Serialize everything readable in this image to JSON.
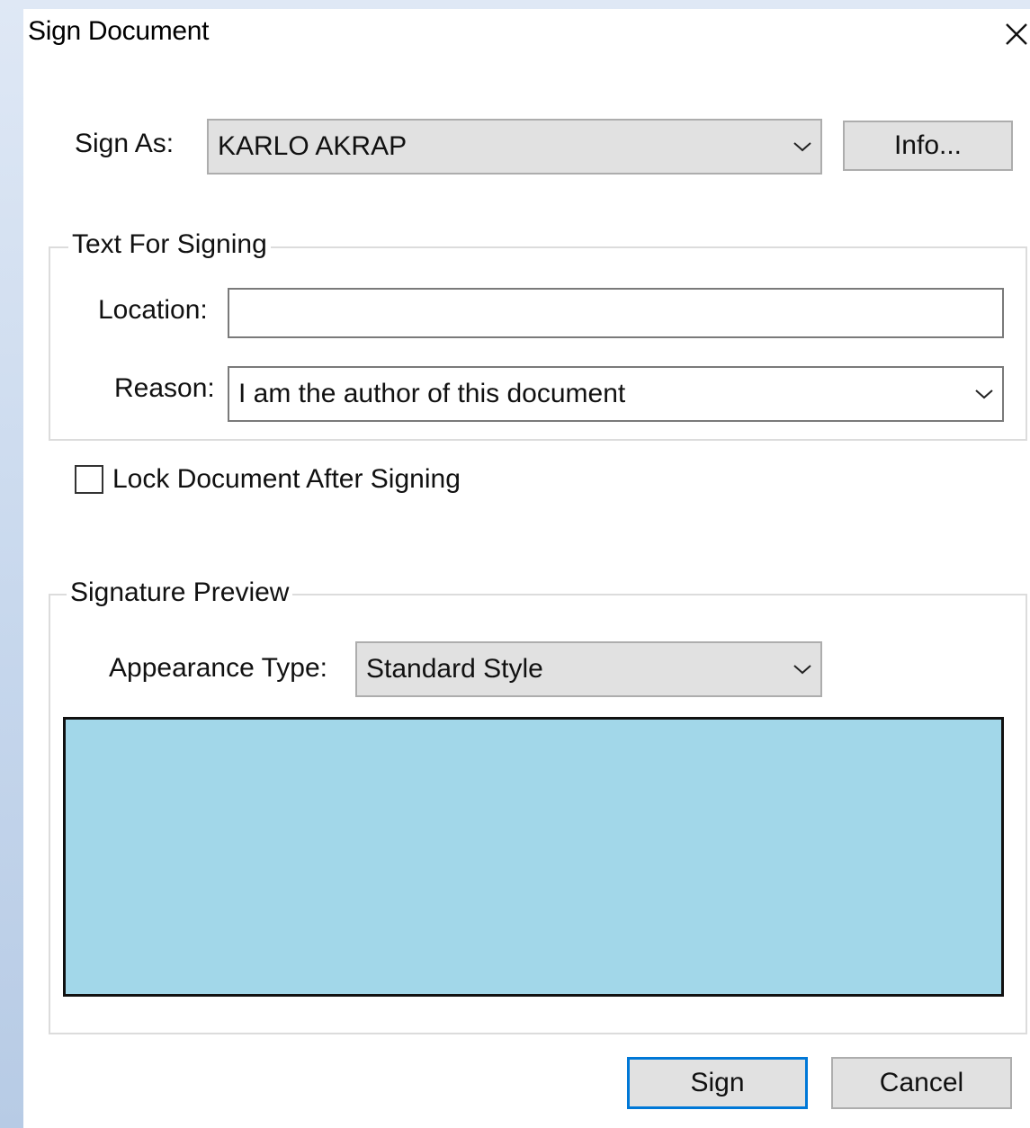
{
  "window": {
    "title": "Sign Document",
    "close_icon": "close-icon"
  },
  "sign_as": {
    "label": "Sign As:",
    "value": "KARLO AKRAP",
    "info_button": "Info..."
  },
  "text_for_signing": {
    "legend": "Text For Signing",
    "location_label": "Location:",
    "location_value": "",
    "reason_label": "Reason:",
    "reason_value": "I am the author of this document"
  },
  "lock_document": {
    "label": "Lock Document After Signing",
    "checked": false
  },
  "signature_preview": {
    "legend": "Signature Preview",
    "appearance_label": "Appearance Type:",
    "appearance_value": "Standard Style",
    "preview_color": "#a2d7e9"
  },
  "actions": {
    "sign_label": "Sign",
    "cancel_label": "Cancel"
  },
  "colors": {
    "default_button_border": "#0078d7",
    "button_face": "#e1e1e1"
  }
}
